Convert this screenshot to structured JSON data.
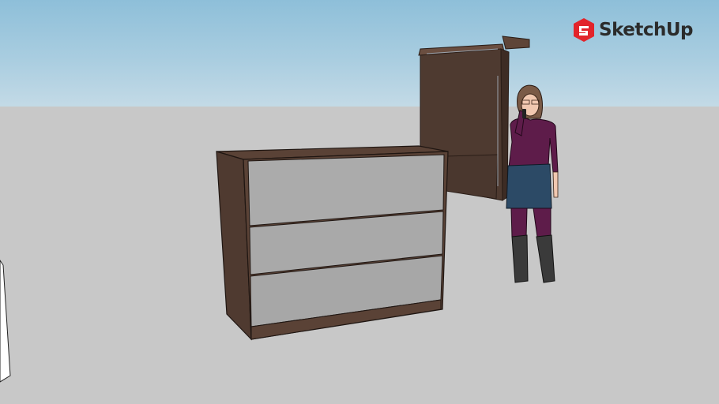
{
  "app": {
    "brand_name": "SketchUp",
    "brand_color": "#e2242b",
    "logo_icon": "sketchup-logo-icon"
  },
  "colors": {
    "sky_top": "#8ebfd9",
    "sky_horizon": "#c3dae6",
    "ground": "#c8c8c8",
    "wood": "#5a4236",
    "drawer_front": "#a9a9a9",
    "sweater": "#5e1c4a",
    "skirt": "#2c4a66"
  },
  "scene": {
    "objects": [
      "chest-of-drawers",
      "tall-cabinet",
      "person-figure",
      "partial-panel"
    ]
  }
}
